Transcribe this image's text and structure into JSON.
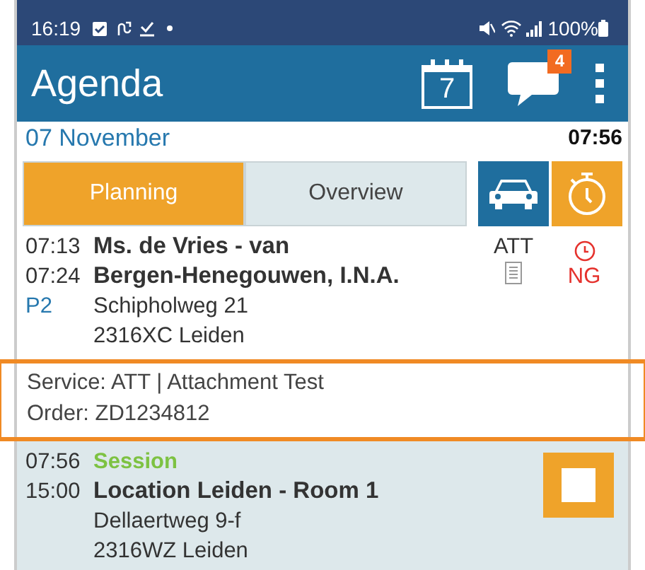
{
  "status_bar": {
    "time": "16:19",
    "battery": "100%"
  },
  "app_bar": {
    "title": "Agenda",
    "calendar_day": "7",
    "message_count": "4"
  },
  "date_row": {
    "date": "07 November",
    "time": "07:56"
  },
  "tabs": [
    {
      "label": "Planning",
      "selected": true
    },
    {
      "label": "Overview",
      "selected": false
    }
  ],
  "appointments": [
    {
      "kind": "visit",
      "start": "07:13",
      "end": "07:24",
      "priority": "P2",
      "title": "Ms. de Vries - van Bergen-Henegouwen, I.N.A.",
      "address": "Schipholweg 21",
      "postcode": "2316XC Leiden",
      "code": "ATT",
      "flag": "NG",
      "service": "Service: ATT | Attachment Test",
      "order": "Order: ZD1234812"
    },
    {
      "kind": "session",
      "start": "07:56",
      "end": "15:00",
      "label": "Session",
      "title": "Location Leiden - Room 1",
      "address": "Dellaertweg 9-f",
      "postcode": "2316WZ Leiden"
    }
  ]
}
